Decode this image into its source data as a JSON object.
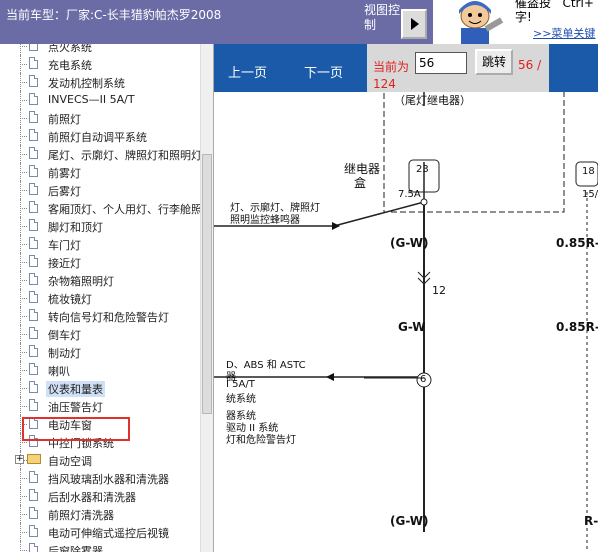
{
  "topbar": {
    "car_label": "当前车型：厂家:C-长丰猎豹帕杰罗2008",
    "view_control": "视图控制"
  },
  "banner": {
    "text_line1": "催盗投",
    "text_line1b": "Ctrl+",
    "text_line2": "字!",
    "link": ">>菜单关键"
  },
  "tree": {
    "items": [
      {
        "label": "点火系统",
        "type": "doc"
      },
      {
        "label": "充电系统",
        "type": "doc"
      },
      {
        "label": "发动机控制系统",
        "type": "doc"
      },
      {
        "label": "INVECS—II 5A/T",
        "type": "doc"
      },
      {
        "label": "前照灯",
        "type": "doc"
      },
      {
        "label": "前照灯自动调平系统",
        "type": "doc"
      },
      {
        "label": "尾灯、示廓灯、牌照灯和照明灯",
        "type": "doc"
      },
      {
        "label": "前雾灯",
        "type": "doc"
      },
      {
        "label": "后雾灯",
        "type": "doc"
      },
      {
        "label": "客厢顶灯、个人用灯、行李舱照明灯",
        "type": "doc"
      },
      {
        "label": "脚灯和顶灯",
        "type": "doc"
      },
      {
        "label": "车门灯",
        "type": "doc"
      },
      {
        "label": "接近灯",
        "type": "doc"
      },
      {
        "label": "杂物箱照明灯",
        "type": "doc"
      },
      {
        "label": "梳妆镜灯",
        "type": "doc"
      },
      {
        "label": "转向信号灯和危险警告灯",
        "type": "doc"
      },
      {
        "label": "倒车灯",
        "type": "doc"
      },
      {
        "label": "制动灯",
        "type": "doc"
      },
      {
        "label": "喇叭",
        "type": "doc"
      },
      {
        "label": "仪表和量表",
        "type": "doc",
        "selected": true
      },
      {
        "label": "油压警告灯",
        "type": "doc"
      },
      {
        "label": "电动车窗",
        "type": "doc"
      },
      {
        "label": "中控门锁系统",
        "type": "doc"
      },
      {
        "label": "自动空调",
        "type": "folder"
      },
      {
        "label": "挡风玻璃刮水器和清洗器",
        "type": "doc"
      },
      {
        "label": "后刮水器和清洗器",
        "type": "doc"
      },
      {
        "label": "前照灯清洗器",
        "type": "doc"
      },
      {
        "label": "电动可伸缩式遥控后视镜",
        "type": "doc"
      },
      {
        "label": "后窗除雾器",
        "type": "doc"
      }
    ]
  },
  "nav": {
    "prev": "上一页",
    "next": "下一页",
    "current_label": "当前为",
    "page_value": "56",
    "go": "跳转",
    "total": "56 /",
    "total2": "124"
  },
  "diagram": {
    "relay_box": "（尾灯继电器）",
    "relay_label1": "继电器",
    "relay_label2": "盒",
    "fuse_23": "23",
    "fuse_amp": "7.5A",
    "fuse_18": "18",
    "fuse_15": "15/",
    "left_text1": "灯、示廓灯、牌照灯",
    "left_text2": "照明监控蜂鸣器",
    "wire_gw1": "(G-W)",
    "wire_085r1": "0.85R-",
    "conn_12": "12",
    "wire_gw2": "G-W",
    "wire_085r2": "0.85R-",
    "abs_text1": "D、ABS 和 ASTC",
    "abs_text2": "器",
    "abs_text3": "I 5A/T",
    "abs_text4": "统系统",
    "abs_text5": "器系统",
    "abs_text6": "驱动 II 系统",
    "abs_text7": "灯和危险警告灯",
    "conn_6": "6",
    "wire_gw3": "(G-W)",
    "wire_r3": "R-"
  }
}
